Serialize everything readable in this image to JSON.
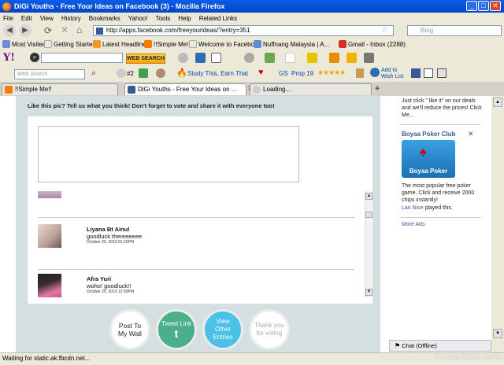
{
  "window": {
    "title": "DiGi Youths - Free Your Ideas on Facebook (3) - Mozilla Firefox"
  },
  "menu": [
    "File",
    "Edit",
    "View",
    "History",
    "Bookmarks",
    "Yahoo!",
    "Tools",
    "Help",
    "Related Links"
  ],
  "nav": {
    "url": "http://apps.facebook.com/freeyourideas/?entry=351",
    "search_placeholder": "Bing"
  },
  "bookmarks": [
    {
      "label": "Most Visited",
      "icon": "gear-icon",
      "color": "#6a8ed6"
    },
    {
      "label": "Getting Started",
      "icon": "page-icon",
      "color": "#e8e8e8"
    },
    {
      "label": "Latest Headlines",
      "icon": "rss-icon",
      "color": "#f79428"
    },
    {
      "label": "!!Simple Me!!",
      "icon": "blogger-icon",
      "color": "#f57d00"
    },
    {
      "label": "Welcome to Facebook",
      "icon": "page-icon",
      "color": "#e8e8e8"
    },
    {
      "label": "Nuffnang Malaysia | A...",
      "icon": "nuffnang-icon",
      "color": "#5a8fd8"
    },
    {
      "label": "Gmail - Inbox (2288)",
      "icon": "gmail-icon",
      "color": "#d93025"
    }
  ],
  "yahoo_toolbar": {
    "search_button": "WEB SEARCH"
  },
  "toolbar2": {
    "search_placeholder": "Web Search",
    "count": "#2",
    "study_link": "Study This, Earn That",
    "gs": "GS",
    "prop": "Prop 19",
    "add_wishlist": "Add to Wish List"
  },
  "tabs": [
    {
      "label": "!!Simple Me!!",
      "color": "#f57d00"
    },
    {
      "label": "DiGi Youths - Free Your Ideas on ...",
      "color": "#3b5998"
    },
    {
      "label": "Loading...",
      "color": "#cccccc"
    }
  ],
  "main": {
    "prompt": "Like this pic? Tell us what you think! Don't forget to vote and share it with everyone too!",
    "comments": [
      {
        "name": "Liyana Bt Ainul",
        "text": "goodluck thereeeeee",
        "date": "October 25, 2010 01:02PM"
      },
      {
        "name": "Afra Yuri",
        "text": "woho! goodluck!!",
        "date": "October 25, 2010 12:59PM"
      }
    ],
    "actions": {
      "post": "Post To My Wall",
      "tweet": "Tweet Link",
      "view": "View Other Entries",
      "thanks": "Thank you for voting"
    },
    "colors": {
      "tweet": "#4cae8b",
      "view": "#4bc1e8"
    }
  },
  "sidebar": {
    "ad_text": "Just click \" like it\" on our deals and we'll reduce the prices! Click Me...",
    "club_title": "Boyaa Poker Club",
    "club_logo": "Boyaa Poker",
    "club_desc": "The most popular free poker game, Click and receive 2000 chips instantly!",
    "played_user": "Lan Nice",
    "played_suffix": " played this.",
    "more_ads": "More Ads",
    "chat": "Chat (Offline)"
  },
  "status": {
    "text": "Waiting for static.ak.fbcdn.net...",
    "watermark": "noorafizan.com"
  }
}
